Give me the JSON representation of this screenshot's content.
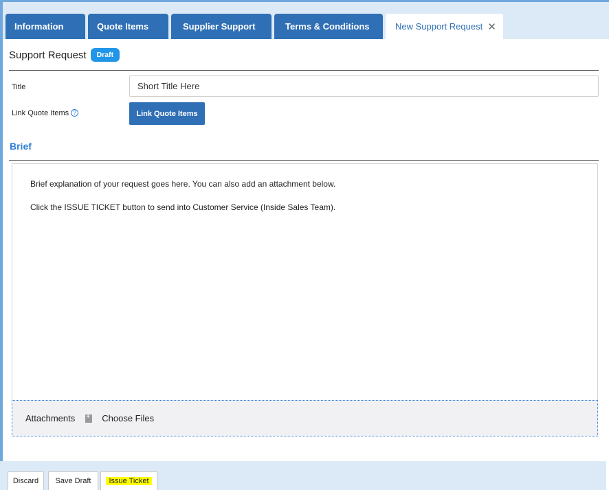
{
  "tabs": [
    {
      "label": "Information"
    },
    {
      "label": "Quote Items"
    },
    {
      "label": "Supplier Support"
    },
    {
      "label": "Terms & Conditions"
    },
    {
      "label": "New Support Request"
    }
  ],
  "header": {
    "title": "Support Request",
    "status_badge": "Draft"
  },
  "form": {
    "title_label": "Title",
    "title_value": "Short Title Here",
    "link_label": "Link Quote Items",
    "link_button": "Link Quote Items"
  },
  "brief": {
    "heading": "Brief",
    "lines": [
      "Brief explanation of your request goes here. You can also add an attachment below.",
      "Click the ISSUE TICKET button to send into Customer Service (Inside Sales Team)."
    ]
  },
  "attachments": {
    "label": "Attachments",
    "choose_files": "Choose Files"
  },
  "footer": {
    "discard": "Discard",
    "save_draft": "Save Draft",
    "issue_ticket": "Issue Ticket"
  },
  "colors": {
    "tab_blue": "#2f6fb5",
    "accent_blue": "#2f7fd8",
    "badge_blue": "#2196e8",
    "highlight": "#ffff00"
  }
}
